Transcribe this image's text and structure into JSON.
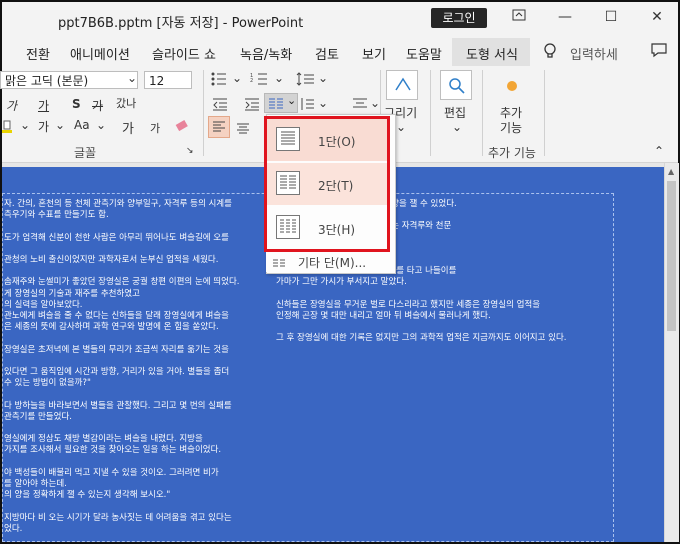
{
  "titlebar": {
    "title": "ppt7B6B.pptm [자동 저장]  -  PowerPoint",
    "login": "로그인",
    "restore_icon": "ribbon-display-icon",
    "minimize": "—",
    "maximize": "☐",
    "close": "✕"
  },
  "tabs": [
    {
      "label": "전환"
    },
    {
      "label": "애니메이션"
    },
    {
      "label": "슬라이드 쇼"
    },
    {
      "label": "녹음/녹화"
    },
    {
      "label": "검토"
    },
    {
      "label": "보기"
    },
    {
      "label": "도움말"
    },
    {
      "label": "도형 서식"
    }
  ],
  "tellme": "입력하세",
  "ribbon": {
    "font_name": "맑은 고딕 (본문)",
    "font_size": "12",
    "font_group_label": "글꼴",
    "drawing_label": "그리기",
    "editing_label": "편집",
    "addins_label": "추가 기능",
    "addins_group_label": "추가 기능",
    "addins_button": "추가\n기능",
    "char_spacing": "가",
    "case_change": "Aa",
    "grow": "가",
    "shrink": "가"
  },
  "dropdown": {
    "options": [
      {
        "label": "1단(O)"
      },
      {
        "label": "2단(T)"
      },
      {
        "label": "3단(H)"
      },
      {
        "label": "기타 단(M)..."
      }
    ]
  },
  "slide_text": {
    "left": [
      "자. 간의, 혼천의 등 천체 관측기와 양부일구, 자격루 등의 시계를",
      "측우기와 수표를 만들기도 함.",
      "",
      "도가 엄격해 신분이 천한 사람은 아무리 뛰어나도 벼슬길에 오를",
      "",
      "관청의 노비 출신이었지만 과학자로서 눈부신 업적을 세웠다.",
      "",
      "솜재주와 눈썰미가 좋았던 장영실은 궁궐 창편 이편의 눈에 띄었다.",
      "게 장영실의 기술과 재주를 추천하였고",
      "의 실력을 알아보았다.",
      "관노에게 벼슬을 줄 수 없다는 신하들을 달래 장영실에게 벼슬을",
      "은 세종의 뜻에 감사하며 과학 연구와 발명에 온 힘을 쏟았다.",
      "",
      "장영실은 초저녁에 본 별들의 무리가 조금씩 자리를 옮기는 것을",
      "",
      "있다면 그 움직임에 시간과 방향, 거리가 있을 거야. 별들을 좀더",
      "수 있는 방법이 없을까?\"",
      "",
      "다 방하늘을 바라보면서 별들을 관찰했다. 그리고 몇 번의 실패를",
      "관측기를 만들었다.",
      "",
      "영실에게 정삼도 채방 별감이라는 벼슬을 내렸다. 지방을",
      "가지를 조사해서 필요한 것을 찾아오는 일을 하는 벼슬이었다.",
      "",
      "야 백성들이 배불리 먹고 지낼 수 있을 것이오. 그러려면 비가",
      "를 알아야 하는데.",
      "의 양을 정확하게 잴 수 있는지 생각해 보시오.\"",
      "",
      "지방마다 비 오는 시기가 달라 농사짓는 데 어려움을 겪고 있다는",
      "었다."
    ],
    "right": [
      "는 측우기를 만들어 정확한 비의 양을 잴 수 있었다.",
      "",
      "를 이용해 종을 울려 시간을 알리는 자격루와 천문",
      "",
      "청계천의 물높이를 재기도 하였다.",
      "",
      "장영실이 책임자가 되어 만든 가마를 타고 나들이를",
      "가마가 그만 가시가 부서지고 말았다.",
      "",
      "신하들은 장영실을 무거운 벌로 다스리라고 했지만 세종은 장영실의 업적을",
      "인정해 곤장 몇 대만 내리고 얼마 뒤 벼슬에서 물러나게 했다.",
      "",
      "그 후 장영실에 대한 기록은 없지만 그의 과학적 업적은 지금까지도 이어지고 있다."
    ]
  }
}
